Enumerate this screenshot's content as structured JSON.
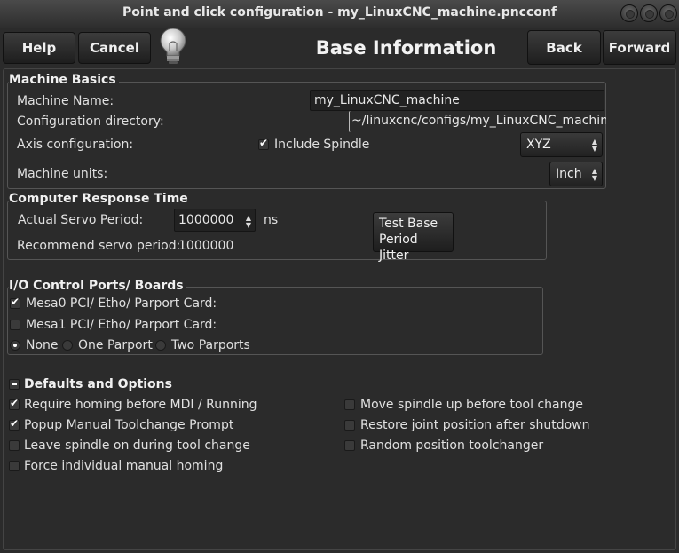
{
  "window": {
    "title": "Point and click configuration - my_LinuxCNC_machine.pncconf"
  },
  "header": {
    "help_label": "Help",
    "cancel_label": "Cancel",
    "page_title": "Base Information",
    "back_label": "Back",
    "forward_label": "Forward"
  },
  "machine_basics": {
    "title": "Machine Basics",
    "name_label": "Machine Name:",
    "name_value": "my_LinuxCNC_machine",
    "config_dir_label": "Configuration directory:",
    "config_dir_value": "~/linuxcnc/configs/my_LinuxCNC_machine",
    "axis_label": "Axis configuration:",
    "include_spindle_label": "Include Spindle",
    "include_spindle_checked": true,
    "axis_value": "XYZ",
    "units_label": "Machine units:",
    "units_value": "Inch"
  },
  "response_time": {
    "title": "Computer Response Time",
    "servo_label": "Actual Servo Period:",
    "servo_value": "1000000",
    "servo_unit": "ns",
    "recommend_label": "Recommend servo period:",
    "recommend_value": "1000000",
    "test_button_line1": "Test Base",
    "test_button_line2": "Period Jitter"
  },
  "io_ports": {
    "title": "I/O Control Ports/ Boards",
    "mesa0_label": "Mesa0 PCI/ Etho/ Parport Card:",
    "mesa0_checked": true,
    "mesa1_label": "Mesa1 PCI/ Etho/ Parport Card:",
    "mesa1_checked": false,
    "parport_options": [
      "None",
      "One Parport",
      "Two Parports"
    ],
    "parport_selected": "None"
  },
  "defaults": {
    "title": "Defaults and Options",
    "left": [
      {
        "label": "Require homing before MDI / Running",
        "checked": true
      },
      {
        "label": "Popup Manual Toolchange Prompt",
        "checked": true
      },
      {
        "label": "Leave spindle on during tool change",
        "checked": false
      },
      {
        "label": "Force individual manual homing",
        "checked": false
      }
    ],
    "right": [
      {
        "label": "Move spindle up before tool change",
        "checked": false
      },
      {
        "label": "Restore joint position after shutdown",
        "checked": false
      },
      {
        "label": "Random position toolchanger",
        "checked": false
      }
    ]
  },
  "colors": {
    "background": "#2b2b2b",
    "text": "#e0e0e0"
  }
}
